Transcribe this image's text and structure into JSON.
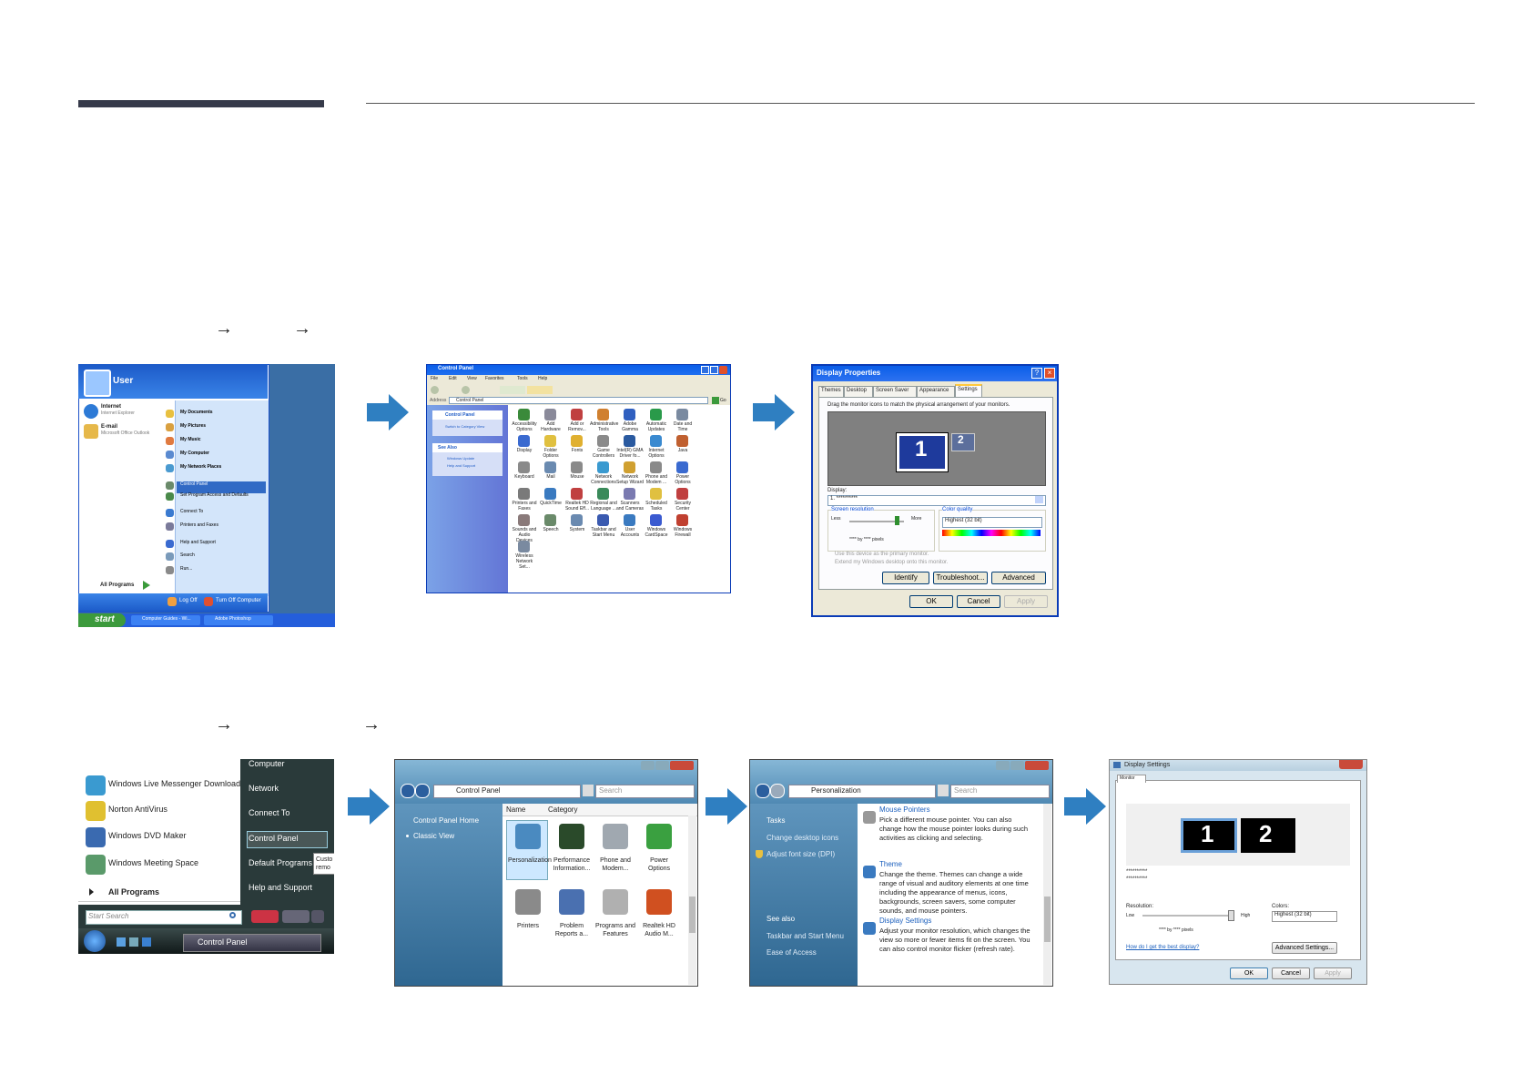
{
  "page": {
    "step_row1": {
      "arrow1": "→",
      "arrow2": "→"
    },
    "step_row2": {
      "arrow1": "→",
      "arrow2": "→"
    }
  },
  "xp_start": {
    "user": "User",
    "left": [
      {
        "title": "Internet",
        "sub": "Internet Explorer"
      },
      {
        "title": "E-mail",
        "sub": "Microsoft Office Outlook"
      }
    ],
    "right": [
      "My Documents",
      "My Pictures",
      "My Music",
      "My Computer",
      "My Network Places",
      "Control Panel",
      "Set Program Access and Defaults",
      "Connect To",
      "Printers and Faxes",
      "Help and Support",
      "Search",
      "Run..."
    ],
    "all_programs": "All Programs",
    "log_off": "Log Off",
    "turn_off": "Turn Off Computer",
    "start": "start",
    "task1": "Computer Guides - Wi...",
    "task2": "Adobe Photoshop"
  },
  "xp_cp": {
    "title": "Control Panel",
    "menu": [
      "File",
      "Edit",
      "View",
      "Favorites",
      "Tools",
      "Help"
    ],
    "address_label": "Address",
    "address": "Control Panel",
    "go": "Go",
    "side_title": "Control Panel",
    "side_link": "Switch to Category View",
    "see_also": "See Also",
    "see_also_links": [
      "Windows Update",
      "Help and Support"
    ],
    "icons": [
      "Accessibility Options",
      "Add Hardware",
      "Add or Remov...",
      "Administrative Tools",
      "Adobe Gamma",
      "Automatic Updates",
      "Date and Time",
      "Display",
      "Folder Options",
      "Fonts",
      "Game Controllers",
      "Intel(R) GMA Driver fo...",
      "Internet Options",
      "Java",
      "Keyboard",
      "Mail",
      "Mouse",
      "Network Connections",
      "Network Setup Wizard",
      "Phone and Modem ...",
      "Power Options",
      "Printers and Faxes",
      "QuickTime",
      "Realtek HD Sound Eff...",
      "Regional and Language ...",
      "Scanners and Cameras",
      "Scheduled Tasks",
      "Security Center",
      "Sounds and Audio Devices",
      "Speech",
      "System",
      "Taskbar and Start Menu",
      "User Accounts",
      "Windows CardSpace",
      "Windows Firewall",
      "Wireless Network Set..."
    ]
  },
  "xp_display": {
    "title": "Display Properties",
    "tabs": [
      "Themes",
      "Desktop",
      "Screen Saver",
      "Appearance",
      "Settings"
    ],
    "instruction": "Drag the monitor icons to match the physical arrangement of your monitors.",
    "mon1": "1",
    "mon2": "2",
    "display_label": "Display:",
    "display_value": "1. **********",
    "res_group": "Screen resolution",
    "less": "Less",
    "more": "More",
    "res_value": "**** by **** pixels",
    "color_group": "Color quality",
    "color_value": "Highest (32 bit)",
    "check1": "Use this device as the primary monitor.",
    "check2": "Extend my Windows desktop onto this monitor.",
    "btn_identify": "Identify",
    "btn_troubleshoot": "Troubleshoot...",
    "btn_advanced": "Advanced",
    "btn_ok": "OK",
    "btn_cancel": "Cancel",
    "btn_apply": "Apply"
  },
  "vista_start": {
    "items": [
      "Windows Live Messenger Download",
      "Norton AntiVirus",
      "Windows DVD Maker",
      "Windows Meeting Space"
    ],
    "all_programs": "All Programs",
    "search_placeholder": "Start Search",
    "right": [
      "Computer",
      "Network",
      "Connect To",
      "Control Panel",
      "Default Programs",
      "Help and Support"
    ],
    "tooltip": "Custo remo",
    "taskbar_item": "Control Panel"
  },
  "vista_cp": {
    "breadcrumb": "Control Panel",
    "search": "Search",
    "side": [
      "Control Panel Home",
      "Classic View"
    ],
    "col_name": "Name",
    "col_category": "Category",
    "icons": [
      "Personalization",
      "Performance Information...",
      "Phone and Modem...",
      "Power Options",
      "Printers",
      "Problem Reports a...",
      "Programs and Features",
      "Realtek HD Audio M..."
    ]
  },
  "vista_pers": {
    "breadcrumb": "Personalization",
    "search": "Search",
    "tasks_title": "Tasks",
    "tasks": [
      "Change desktop icons",
      "Adjust font size (DPI)"
    ],
    "see_also": "See also",
    "see_also_links": [
      "Taskbar and Start Menu",
      "Ease of Access"
    ],
    "items": [
      {
        "title": "Mouse Pointers",
        "desc": "Pick a different mouse pointer. You can also change how the mouse pointer looks during such activities as clicking and selecting."
      },
      {
        "title": "Theme",
        "desc": "Change the theme. Themes can change a wide range of visual and auditory elements at one time including the appearance of menus, icons, backgrounds, screen savers, some computer sounds, and mouse pointers."
      },
      {
        "title": "Display Settings",
        "desc": "Adjust your monitor resolution, which changes the view so more or fewer items fit on the screen. You can also control monitor flicker (refresh rate)."
      }
    ]
  },
  "vista_display": {
    "title": "Display Settings",
    "tab": "Monitor",
    "mon1": "1",
    "mon2": "2",
    "info1": "**********",
    "info2": "**********",
    "resolution": "Resolution:",
    "low": "Low",
    "high": "High",
    "res_value": "**** by **** pixels",
    "colors": "Colors:",
    "colors_value": "Highest (32 bit)",
    "help_link": "How do I get the best display?",
    "advanced": "Advanced Settings...",
    "ok": "OK",
    "cancel": "Cancel",
    "apply": "Apply"
  },
  "colors": {
    "xp_blue": "#245edb",
    "vista_aero": "#5e9ec4",
    "arrow": "#2f7fc1"
  }
}
